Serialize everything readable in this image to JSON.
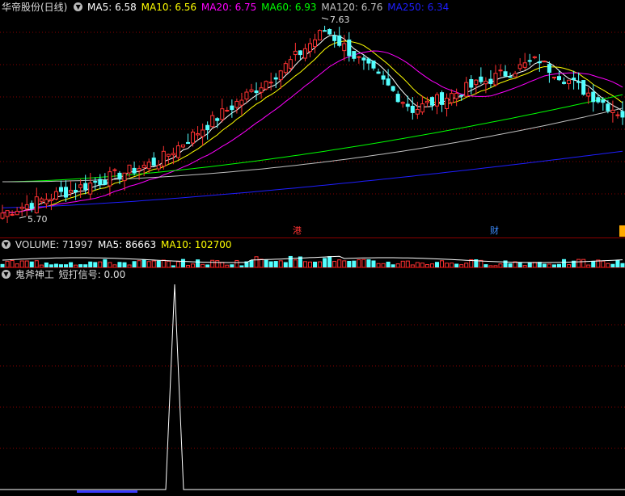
{
  "main": {
    "title": "华帝股份(日线)",
    "ma5": "MA5: 6.58",
    "ma10": "MA10: 6.56",
    "ma20": "MA20: 6.75",
    "ma60": "MA60: 6.93",
    "ma120": "MA120: 6.76",
    "ma250": "MA250: 6.34",
    "high_label": "7.63",
    "low_label": "5.70",
    "marker_hk": "港",
    "marker_cai": "财"
  },
  "volume": {
    "label": "VOLUME: 71997",
    "ma5": "MA5: 86663",
    "ma10": "MA10: 102700"
  },
  "indicator": {
    "name": "鬼斧神工",
    "signal": "短打信号: 0.00"
  },
  "colors": {
    "up": "#ff3232",
    "down": "#54ffff",
    "ma5": "#ffffff",
    "ma10": "#ffff00",
    "ma20": "#ff00ff",
    "ma60": "#00ff00",
    "ma120": "#c0c0c0",
    "ma250": "#1e1eff",
    "grid": "#8b0000"
  }
}
